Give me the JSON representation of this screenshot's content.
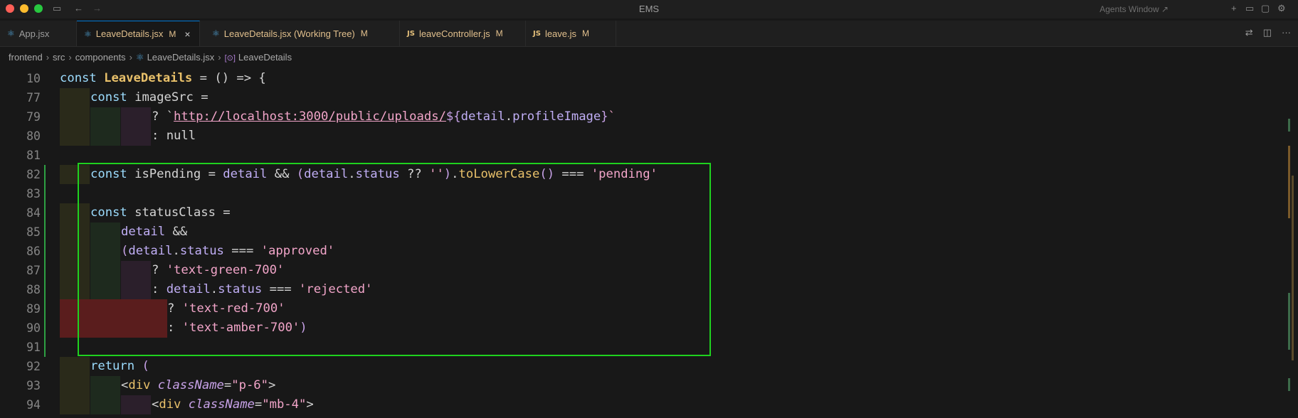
{
  "window": {
    "title": "EMS",
    "agents_label": "Agents Window ↗"
  },
  "tabs": [
    {
      "label": "App.jsx",
      "kind": "react",
      "modified": ""
    },
    {
      "label": "LeaveDetails.jsx",
      "kind": "react",
      "modified": "M",
      "active": true
    },
    {
      "label": "LeaveDetails.jsx (Working Tree)",
      "kind": "react",
      "modified": "M"
    },
    {
      "label": "leaveController.js",
      "kind": "js",
      "modified": "M"
    },
    {
      "label": "leave.js",
      "kind": "js",
      "modified": "M"
    }
  ],
  "breadcrumb": [
    "frontend",
    "src",
    "components",
    "LeaveDetails.jsx",
    "LeaveDetails"
  ],
  "line_numbers": [
    "10",
    "77",
    "79",
    "80",
    "81",
    "82",
    "83",
    "84",
    "85",
    "86",
    "87",
    "88",
    "89",
    "90",
    "91",
    "92",
    "93",
    "94"
  ],
  "code": {
    "l10": {
      "kw": "const",
      "name": "LeaveDetails",
      "rest": " = () => {"
    },
    "l77": {
      "kw": "const",
      "rest": " imageSrc ="
    },
    "l79": {
      "q": "? `",
      "url": "http://localhost:3000/public/uploads/",
      "t1": "${",
      "obj": "detail",
      "dot": ".",
      "prop": "profileImage",
      "t2": "}",
      "end": "`"
    },
    "l80": {
      "text": ": null"
    },
    "l82": {
      "kw": "const",
      "p1": " isPending = ",
      "obj": "detail",
      "p2": " && ",
      "pa": "(",
      "obj2": "detail",
      "dot": ".",
      "prop": "status",
      "p3": " ?? ",
      "s1": "''",
      "pb": ")",
      "dot2": ".",
      "fn": "toLowerCase",
      "pc": "()",
      "p4": " === ",
      "s2": "'pending'"
    },
    "l84": {
      "kw": "const",
      "rest": " statusClass ="
    },
    "l85": {
      "obj": "detail",
      "rest": " &&"
    },
    "l86": {
      "pa": "(",
      "obj": "detail",
      "dot": ".",
      "prop": "status",
      "p1": " === ",
      "s1": "'approved'"
    },
    "l87": {
      "q": "? ",
      "s1": "'text-green-700'"
    },
    "l88": {
      "q": ": ",
      "obj": "detail",
      "dot": ".",
      "prop": "status",
      "p1": " === ",
      "s1": "'rejected'"
    },
    "l89": {
      "q": "? ",
      "s1": "'text-red-700'"
    },
    "l90": {
      "q": ": ",
      "s1": "'text-amber-700'",
      "pb": ")"
    },
    "l92": {
      "kw": "return",
      "pa": " ("
    },
    "l93": {
      "lt": "<",
      "tag": "div",
      "attr": " className",
      "eq": "=",
      "val": "\"p-6\"",
      "gt": ">"
    },
    "l94": {
      "lt": "<",
      "tag": "div",
      "attr": " className",
      "eq": "=",
      "val": "\"mb-4\"",
      "gt": ">"
    }
  },
  "colors": {
    "accent": "#0078d4",
    "selection_box": "#1fd11f",
    "diff_added": "#2ea043",
    "diff_removed": "#5a1d1d"
  }
}
